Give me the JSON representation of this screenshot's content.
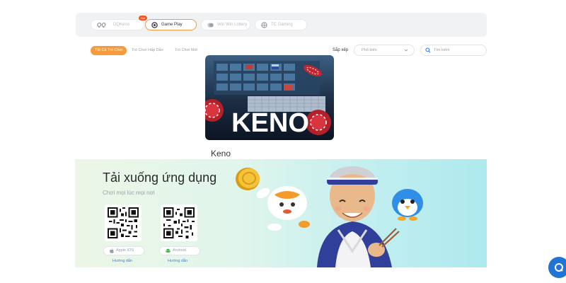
{
  "providers": {
    "tabs": [
      {
        "label": "DQKeno",
        "icon": "dq-logo-icon",
        "badge": "Hot"
      },
      {
        "label": "Game Play",
        "icon": "gameplay-icon",
        "active": true
      },
      {
        "label": "Win Win Lottery",
        "icon": "winwin-icon"
      },
      {
        "label": "TC Gaming",
        "icon": "tc-gaming-icon"
      }
    ]
  },
  "filters": {
    "chips": [
      "Tất Cả Trò Chơi",
      "Trò Chơi Hấp Dẫn",
      "Trò Chơi Mới"
    ],
    "sort_label": "Sắp xếp",
    "sort_value": "Phổ biến",
    "search_placeholder": "Tìm kiếm"
  },
  "game": {
    "title": "Keno",
    "image_text": "KENO"
  },
  "download": {
    "title": "Tải xuống ứng dụng",
    "subtitle": "Chơi mọi lúc mọi nơi",
    "ios_label": "Apple IOS",
    "android_label": "Android",
    "guide_label": "Hướng dẫn"
  },
  "colors": {
    "accent": "#f79a3c",
    "link": "#3d7ee0",
    "support": "#1f74d6"
  }
}
